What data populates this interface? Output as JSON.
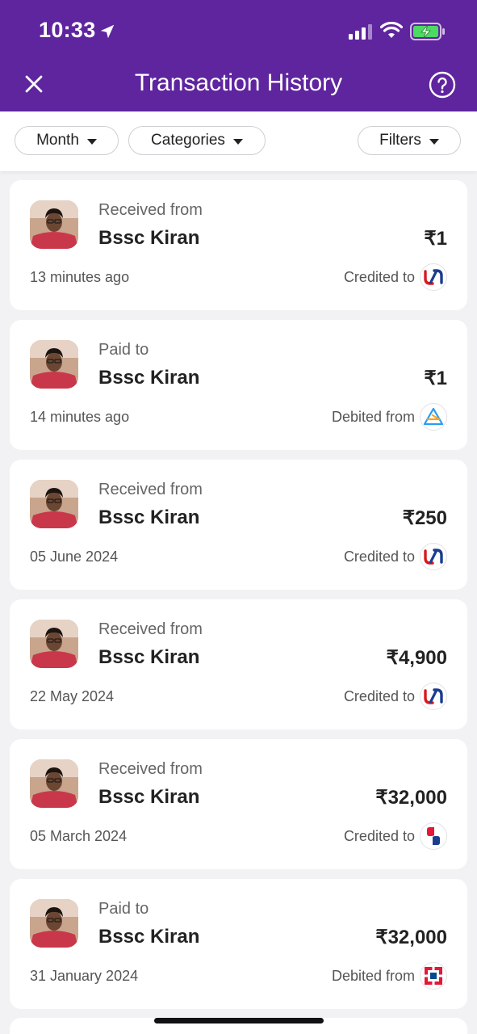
{
  "status_bar": {
    "time": "10:33"
  },
  "header": {
    "title": "Transaction History"
  },
  "filters": {
    "month": "Month",
    "categories": "Categories",
    "filters": "Filters"
  },
  "colors": {
    "brand": "#5f259f",
    "union_bank_red": "#d71920",
    "union_bank_blue": "#1a3d8f",
    "hdfc_red": "#e31837",
    "hdfc_blue": "#004c8f"
  },
  "transactions": [
    {
      "type": "Received from",
      "name": "Bssc Kiran",
      "amount": "₹1",
      "time": "13 minutes ago",
      "account_label": "Credited to",
      "bank_icon": "union-bank-icon"
    },
    {
      "type": "Paid to",
      "name": "Bssc Kiran",
      "amount": "₹1",
      "time": "14 minutes ago",
      "account_label": "Debited from",
      "bank_icon": "upi-lite-icon"
    },
    {
      "type": "Received from",
      "name": "Bssc Kiran",
      "amount": "₹250",
      "time": "05 June 2024",
      "account_label": "Credited to",
      "bank_icon": "union-bank-icon"
    },
    {
      "type": "Received from",
      "name": "Bssc Kiran",
      "amount": "₹4,900",
      "time": "22 May 2024",
      "account_label": "Credited to",
      "bank_icon": "union-bank-icon"
    },
    {
      "type": "Received from",
      "name": "Bssc Kiran",
      "amount": "₹32,000",
      "time": "05 March 2024",
      "account_label": "Credited to",
      "bank_icon": "bank-icon"
    },
    {
      "type": "Paid to",
      "name": "Bssc Kiran",
      "amount": "₹32,000",
      "time": "31 January 2024",
      "account_label": "Debited from",
      "bank_icon": "hdfc-bank-icon"
    }
  ]
}
